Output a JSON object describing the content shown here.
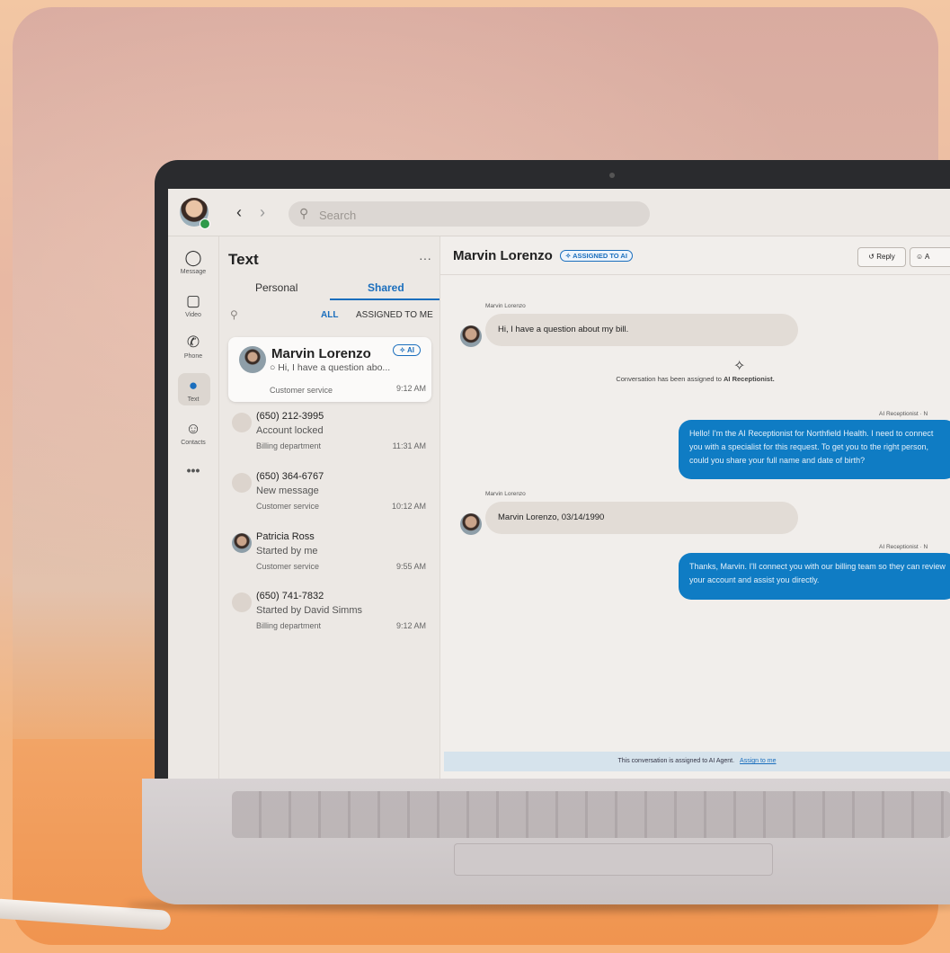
{
  "topbar": {
    "search_placeholder": "Search"
  },
  "rail": [
    {
      "label": "Message",
      "icon": "message-icon"
    },
    {
      "label": "Video",
      "icon": "video-icon"
    },
    {
      "label": "Phone",
      "icon": "phone-icon"
    },
    {
      "label": "Text",
      "icon": "chat-bubble-icon",
      "active": true
    },
    {
      "label": "Contacts",
      "icon": "contacts-icon"
    },
    {
      "label": "•••",
      "icon": "more-icon"
    }
  ],
  "listpane": {
    "title": "Text",
    "more": "···",
    "tabs": [
      "Personal",
      "Shared"
    ],
    "filters": [
      "ALL",
      "ASSIGNED TO ME"
    ],
    "selected": {
      "name": "Marvin Lorenzo",
      "preview": "Hi, I have a question abo...",
      "badge": "AI",
      "dept": "Customer service",
      "time": "9:12 AM"
    },
    "conversations": [
      {
        "name": "(650) 212-3995",
        "preview": "Account locked",
        "dept": "Billing department",
        "time": "11:31 AM"
      },
      {
        "name": "(650) 364-6767",
        "preview": "New message",
        "dept": "Customer service",
        "time": "10:12 AM"
      },
      {
        "name": "Patricia Ross",
        "preview": "Started by me",
        "dept": "Customer service",
        "time": "9:55 AM"
      },
      {
        "name": "(650) 741-7832",
        "preview": "Started by David Simms",
        "dept": "Billing department",
        "time": "9:12 AM"
      }
    ]
  },
  "chat": {
    "name": "Marvin Lorenzo",
    "status_pill": "ASSIGNED TO AI",
    "reply_label": "Reply",
    "assign_label": "A",
    "messages": [
      {
        "sender": "Marvin Lorenzo",
        "text": "Hi, I have a question about my bill."
      },
      {
        "sender": "Marvin Lorenzo",
        "text": "Marvin Lorenzo, 03/14/1990"
      }
    ],
    "system_text_prefix": "Conversation has been assigned to ",
    "system_text_bold": "AI Receptionist.",
    "ai_label": "AI Receptionist · N",
    "ai_messages": [
      "Hello! I'm the AI Receptionist for Northfield Health. I need to connect you with a specialist for this request. To get you to the right person, could you share your full name and date of birth?",
      "Thanks, Marvin. I'll connect you with our billing team so they can review your account and assist you directly."
    ],
    "footer_text": "This conversation is assigned to AI Agent.",
    "footer_link": "Assign to me"
  }
}
